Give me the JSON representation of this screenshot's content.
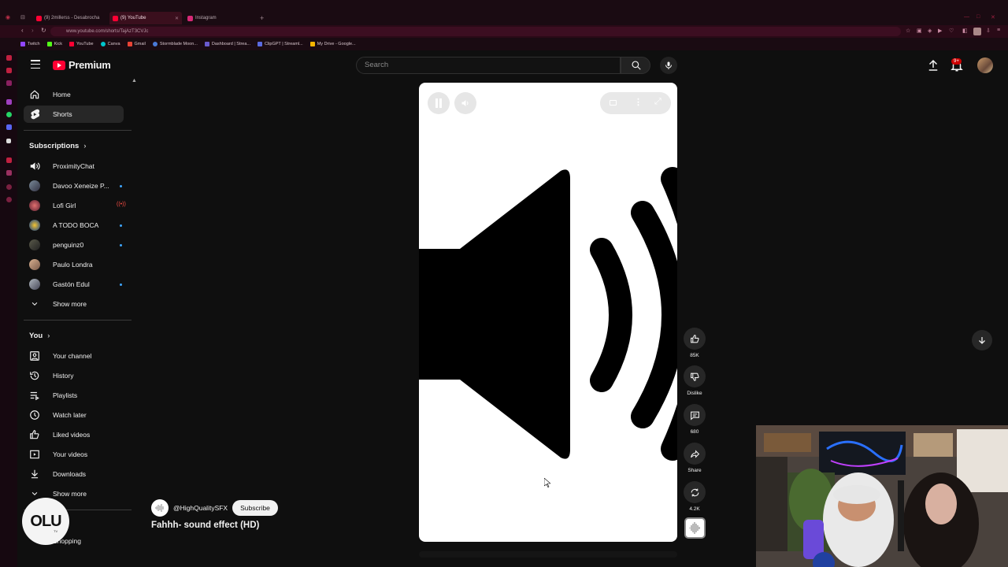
{
  "browser": {
    "tabs": [
      {
        "label": "(9) 2millerss - Desabrocha"
      },
      {
        "label": "(9) YouTube"
      },
      {
        "label": "Instagram"
      }
    ],
    "url": "www.youtube.com/shorts/TajAzT3CVJc",
    "bookmarks": [
      "Twitch",
      "Kick",
      "YouTube",
      "Canva",
      "Gmail",
      "Stormblade Moon...",
      "Dashboard | Strea...",
      "ClipGPT | Streaml...",
      "My Drive - Google..."
    ]
  },
  "header": {
    "logo_text": "Premium",
    "search_placeholder": "Search",
    "notification_count": "9+"
  },
  "guide": {
    "main": [
      {
        "label": "Home",
        "icon": "home-icon"
      },
      {
        "label": "Shorts",
        "icon": "shorts-icon",
        "active": true
      }
    ],
    "subscriptions_header": "Subscriptions",
    "subscriptions": [
      {
        "label": "ProximityChat"
      },
      {
        "label": "Davoo Xeneize P..."
      },
      {
        "label": "Lofi Girl"
      },
      {
        "label": "A TODO BOCA"
      },
      {
        "label": "penguinz0"
      },
      {
        "label": "Paulo Londra"
      },
      {
        "label": "Gastón Edul"
      }
    ],
    "subs_show_more": "Show more",
    "you_header": "You",
    "you": [
      {
        "label": "Your channel",
        "icon": "channel-icon"
      },
      {
        "label": "History",
        "icon": "history-icon"
      },
      {
        "label": "Playlists",
        "icon": "playlists-icon"
      },
      {
        "label": "Watch later",
        "icon": "clock-icon"
      },
      {
        "label": "Liked videos",
        "icon": "thumb-up-icon"
      },
      {
        "label": "Your videos",
        "icon": "video-icon"
      },
      {
        "label": "Downloads",
        "icon": "download-icon"
      }
    ],
    "you_show_more": "Show more",
    "shopping": "Shopping"
  },
  "short": {
    "channel": "@HighQualitySFX",
    "subscribe_label": "Subscribe",
    "title": "Fahhh- sound effect (HD)"
  },
  "actions": {
    "likes": "85K",
    "dislike_label": "Dislike",
    "comments": "680",
    "share_label": "Share",
    "remix": "4.2K"
  },
  "overlay": {
    "streamer_logo": "OLU",
    "streamer_logo_sub": "TV"
  },
  "colors": {
    "brand_red": "#ff0033",
    "background": "#0f0f0f",
    "browser_accent": "#3a0f1d",
    "link_blue": "#3ea6ff"
  }
}
